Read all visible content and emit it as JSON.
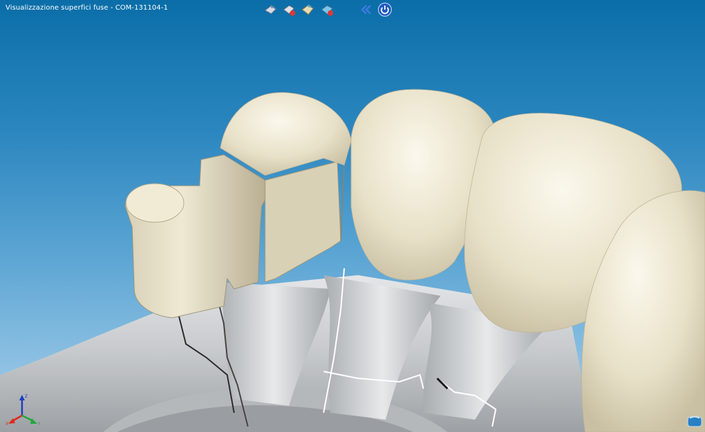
{
  "window": {
    "title": "Visualizzazione superfici fuse  - COM-131104-1"
  },
  "toolbar": {
    "buttons": [
      {
        "name": "scan-view-icon",
        "color": "#6b8db3"
      },
      {
        "name": "scan-remove-icon",
        "color": "#d93a3a"
      },
      {
        "name": "tooth-model-icon",
        "color": "#c9b98a"
      },
      {
        "name": "mesh-remove-icon",
        "color": "#4b9fd0"
      }
    ],
    "nav": [
      {
        "name": "back-double-chevron-icon",
        "glyph": "«"
      },
      {
        "name": "power-icon"
      }
    ]
  },
  "axis_gizmo": {
    "labels": {
      "x": "X",
      "y": "Y",
      "z": "Z"
    },
    "colors": {
      "x": "#e0281c",
      "y": "#1fa83a",
      "z": "#1e3fbf"
    }
  },
  "colors": {
    "tooth": "#ece6d0",
    "gum": "#cfd2d4",
    "accent": "#0b6ea8"
  }
}
